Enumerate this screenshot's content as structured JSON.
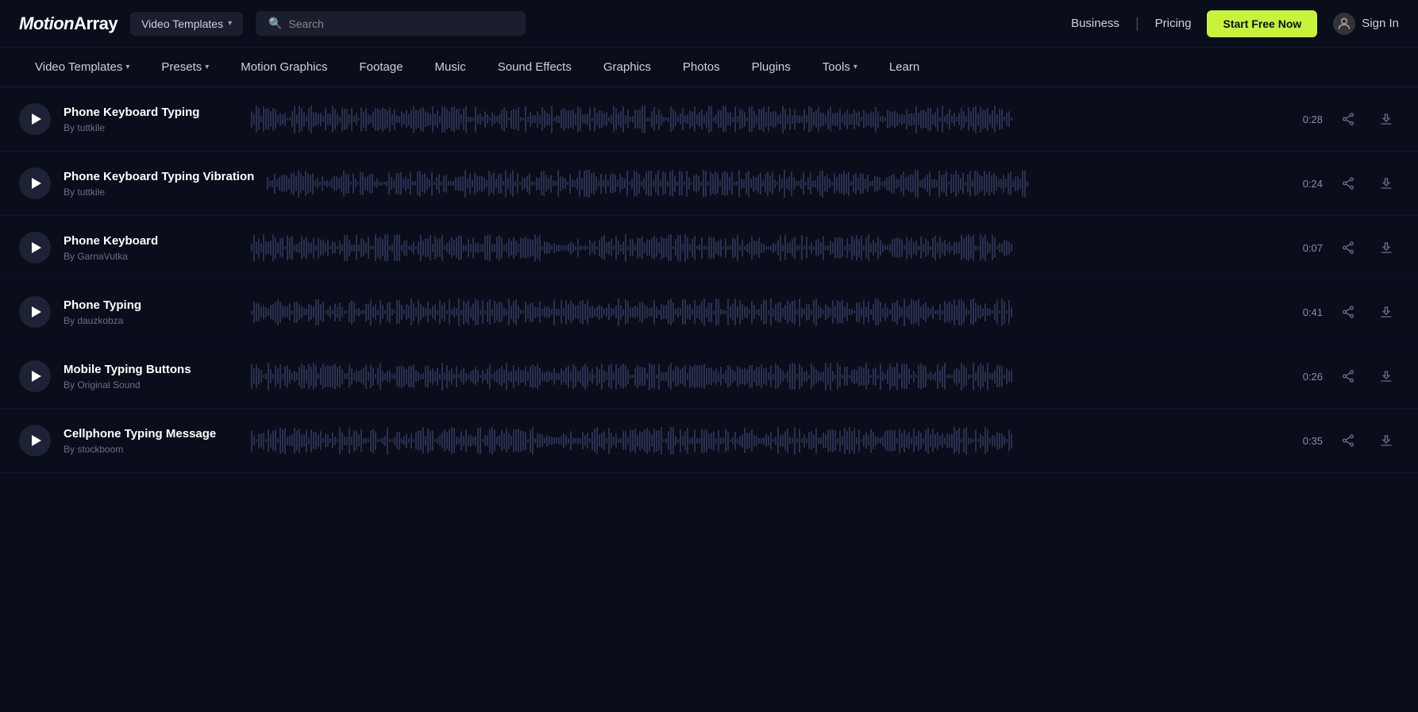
{
  "header": {
    "logo": "MotionArray",
    "dropdown_label": "Video Templates",
    "search_placeholder": "Search",
    "business_label": "Business",
    "pricing_label": "Pricing",
    "start_free_label": "Start Free Now",
    "sign_in_label": "Sign In"
  },
  "navbar": {
    "items": [
      {
        "id": "video-templates",
        "label": "Video Templates",
        "has_dropdown": true
      },
      {
        "id": "presets",
        "label": "Presets",
        "has_dropdown": true
      },
      {
        "id": "motion-graphics",
        "label": "Motion Graphics",
        "has_dropdown": false
      },
      {
        "id": "footage",
        "label": "Footage",
        "has_dropdown": false
      },
      {
        "id": "music",
        "label": "Music",
        "has_dropdown": false
      },
      {
        "id": "sound-effects",
        "label": "Sound Effects",
        "has_dropdown": false
      },
      {
        "id": "graphics",
        "label": "Graphics",
        "has_dropdown": false
      },
      {
        "id": "photos",
        "label": "Photos",
        "has_dropdown": false
      },
      {
        "id": "plugins",
        "label": "Plugins",
        "has_dropdown": false
      },
      {
        "id": "tools",
        "label": "Tools",
        "has_dropdown": true
      },
      {
        "id": "learn",
        "label": "Learn",
        "has_dropdown": false
      }
    ]
  },
  "tracks": [
    {
      "id": "track-1",
      "title": "Phone Keyboard Typing",
      "author": "By tuttkile",
      "duration": "0:28",
      "waveform_seed": 1
    },
    {
      "id": "track-2",
      "title": "Phone Keyboard Typing Vibration",
      "author": "By tuttkile",
      "duration": "0:24",
      "waveform_seed": 2
    },
    {
      "id": "track-3",
      "title": "Phone Keyboard",
      "author": "By GarnaVutka",
      "duration": "0:07",
      "waveform_seed": 3
    },
    {
      "id": "track-4",
      "title": "Phone Typing",
      "author": "By dauzkobza",
      "duration": "0:41",
      "waveform_seed": 4
    },
    {
      "id": "track-5",
      "title": "Mobile Typing Buttons",
      "author": "By Original Sound",
      "duration": "0:26",
      "waveform_seed": 5
    },
    {
      "id": "track-6",
      "title": "Cellphone Typing Message",
      "author": "By stockboom",
      "duration": "0:35",
      "waveform_seed": 6
    }
  ]
}
